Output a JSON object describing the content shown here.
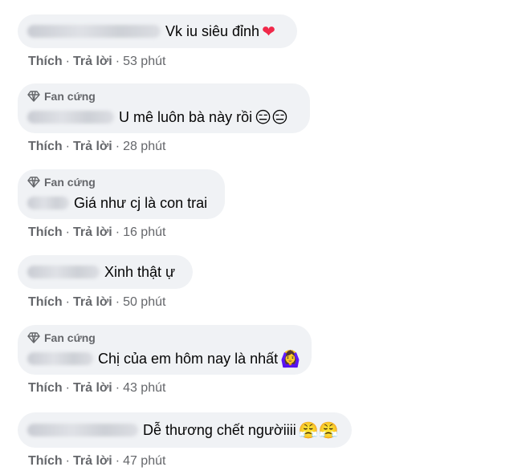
{
  "badge_label": "Fan cứng",
  "comments": [
    {
      "text": "Vk iu siêu đỉnh",
      "emoji": "❤",
      "time": "53 phút",
      "fan": false
    },
    {
      "text": "U mê luôn bà này rồi",
      "emoji": "😑😑",
      "time": "28 phút",
      "fan": true
    },
    {
      "text": "Giá như cj là con trai",
      "emoji": "",
      "time": "16 phút",
      "fan": true
    },
    {
      "text": "Xinh thật ự",
      "emoji": "",
      "time": "50 phút",
      "fan": false
    },
    {
      "text": "Chị của em hôm nay là nhất",
      "emoji": "🙆‍♀️",
      "time": "43 phút",
      "fan": true
    },
    {
      "text": "Dễ thương chết ngườiiii",
      "emoji": "😤😤",
      "time": "47 phút",
      "fan": false
    }
  ],
  "actions": {
    "like": "Thích",
    "reply": "Trả lời",
    "separator": "·"
  },
  "colors": {
    "bubble": "#f0f2f5",
    "meta_text": "#65676b",
    "text": "#050505",
    "heart": "#f02849"
  }
}
